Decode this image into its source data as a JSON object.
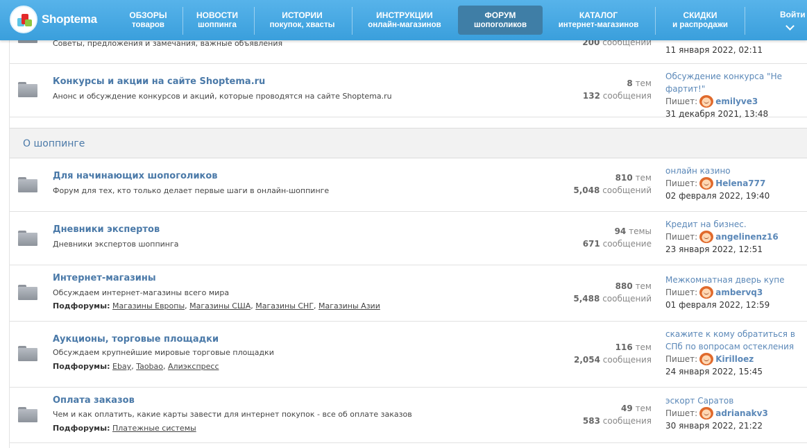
{
  "header": {
    "logo_text": "Shoptema",
    "nav": [
      {
        "line1": "ОБЗОРЫ",
        "line2": "товаров"
      },
      {
        "line1": "НОВОСТИ",
        "line2": "шоппинга"
      },
      {
        "line1": "ИСТОРИИ",
        "line2": "покупок, хвасты"
      },
      {
        "line1": "ИНСТРУКЦИИ",
        "line2": "онлайн-магазинов"
      },
      {
        "line1": "ФОРУМ",
        "line2": "шопоголиков"
      },
      {
        "line1": "КАТАЛОГ",
        "line2": "интернет-магазинов"
      },
      {
        "line1": "СКИДКИ",
        "line2": "и распродажи"
      }
    ],
    "active_nav": "ФОРУМ",
    "login_label": "Войти"
  },
  "partial_row": {
    "desc": "Советы, предложения и замечания, важные объявления",
    "messages_count": "200",
    "messages_label": "сообщений",
    "last_date": "11 января 2022, 02:11"
  },
  "forums_top": [
    {
      "title": "Конкурсы и акции на сайте Shoptema.ru",
      "desc": "Анонс и обсуждение конкурсов и акций, которые проводятся на сайте Shoptema.ru",
      "topics_count": "8",
      "topics_label": "тем",
      "messages_count": "132",
      "messages_label": "сообщения",
      "last_title": "Обсуждение конкурса \"Не фартит!\"",
      "by_label": "Пишет:",
      "last_user": "emilyve3",
      "last_date": "31 декабря 2021, 13:48"
    }
  ],
  "category": {
    "title": "О шоппинге"
  },
  "forums": [
    {
      "title": "Для начинающих шопоголиков",
      "desc": "Форум для тех, кто только делает первые шаги в онлайн-шоппинге",
      "topics_count": "810",
      "topics_label": "тем",
      "messages_count": "5,048",
      "messages_label": "сообщений",
      "last_title": "онлайн казино",
      "by_label": "Пишет:",
      "last_user": "Helena777",
      "last_date": "02 февраля 2022, 19:40"
    },
    {
      "title": "Дневники экспертов",
      "desc": "Дневники экспертов шоппинга",
      "topics_count": "94",
      "topics_label": "темы",
      "messages_count": "671",
      "messages_label": "сообщение",
      "last_title": "Кредит на бизнес.",
      "by_label": "Пишет:",
      "last_user": "angelinenz16",
      "last_date": "23 января 2022, 12:51"
    },
    {
      "title": "Интернет-магазины",
      "desc": "Обсуждаем интернет-магазины всего мира",
      "subforums_label": "Подфорумы:",
      "subforums": [
        "Магазины Европы",
        "Магазины США",
        "Магазины СНГ",
        "Магазины Азии"
      ],
      "topics_count": "880",
      "topics_label": "тем",
      "messages_count": "5,488",
      "messages_label": "сообщений",
      "last_title": "Межкомнатная дверь купе",
      "by_label": "Пишет:",
      "last_user": "ambervq3",
      "last_date": "01 февраля 2022, 12:59"
    },
    {
      "title": "Аукционы, торговые площадки",
      "desc": "Обсуждаем крупнейшие мировые торговые площадки",
      "subforums_label": "Подфорумы:",
      "subforums": [
        "Ebay",
        "Taobao",
        "Алиэкспресс"
      ],
      "topics_count": "116",
      "topics_label": "тем",
      "messages_count": "2,054",
      "messages_label": "сообщения",
      "last_title": "скажите к кому обратиться в СПб по вопросам остекления",
      "by_label": "Пишет:",
      "last_user": "Kirilloez",
      "last_date": "24 января 2022, 15:45"
    },
    {
      "title": "Оплата заказов",
      "desc": "Чем и как оплатить, какие карты завести для интернет покупок - все об оплате заказов",
      "subforums_label": "Подфорумы:",
      "subforums": [
        "Платежные системы"
      ],
      "topics_count": "49",
      "topics_label": "тем",
      "messages_count": "583",
      "messages_label": "сообщения",
      "last_title": "эскорт Саратов",
      "by_label": "Пишет:",
      "last_user": "adrianakv3",
      "last_date": "30 января 2022, 21:22"
    }
  ],
  "colors": {
    "header_blue": "#4aa9e3",
    "active_tab": "#3f7ea6",
    "link_blue": "#4a79a8"
  }
}
